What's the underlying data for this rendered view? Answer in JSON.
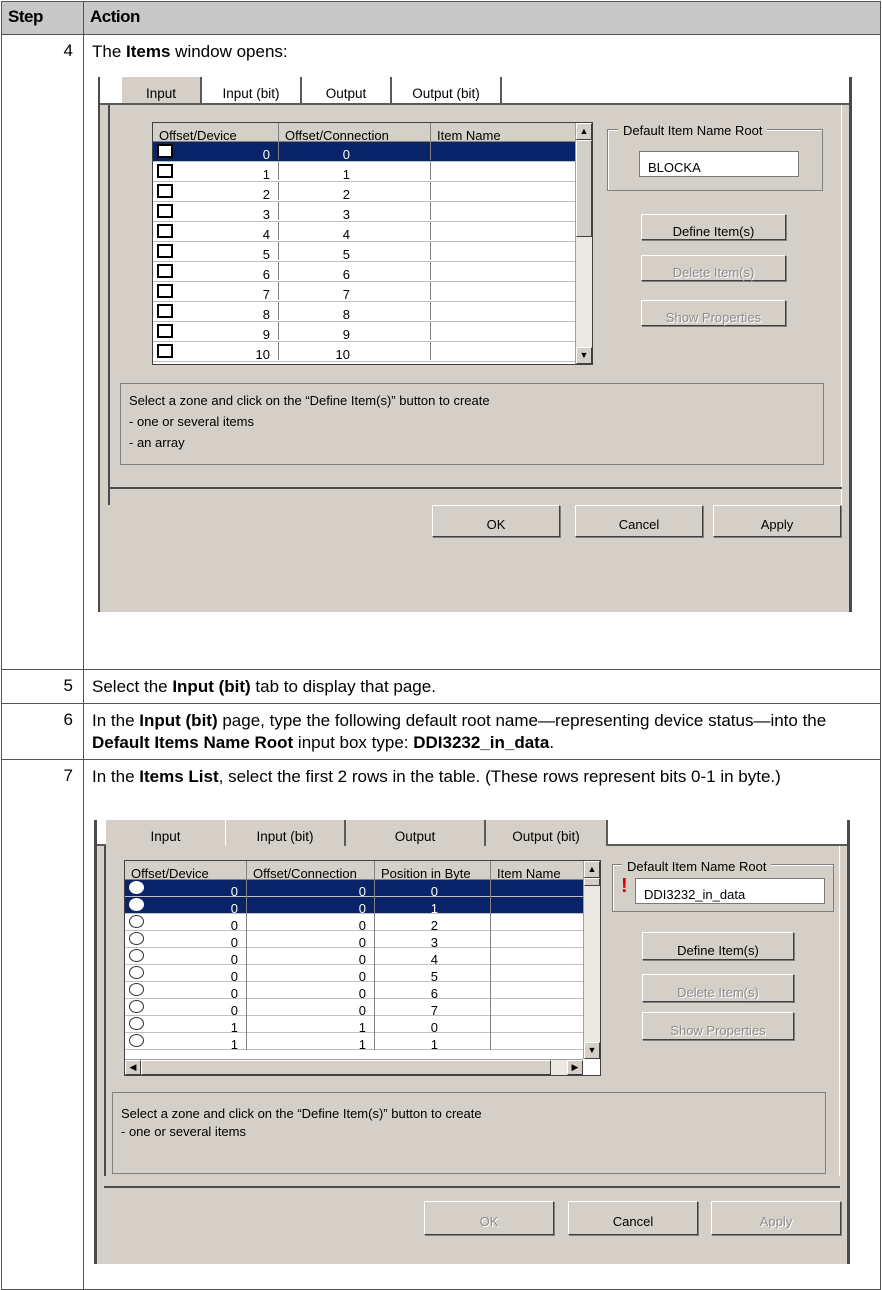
{
  "table": {
    "header_step": "Step",
    "header_action": "Action"
  },
  "steps": {
    "s4": {
      "num": "4",
      "t1": "The ",
      "b1": "Items",
      "t2": " window opens:"
    },
    "s5": {
      "num": "5",
      "t1": "Select the ",
      "b1": "Input (bit)",
      "t2": " tab to display that page."
    },
    "s6": {
      "num": "6",
      "t1": "In the ",
      "b1": "Input (bit)",
      "t2": " page, type the following default root name—representing device status—into the ",
      "b2": "Default Items Name Root",
      "t3": " input box type: ",
      "b3": "DDI3232_in_data",
      "t4": "."
    },
    "s7": {
      "num": "7",
      "t1": "In the ",
      "b1": "Items List",
      "t2": ", select the first 2 rows in the table. (These rows represent bits 0-1 in byte.)"
    }
  },
  "dialog1": {
    "tabs": [
      "Input",
      "Input (bit)",
      "Output",
      "Output (bit)"
    ],
    "columns": [
      "Offset/Device",
      "Offset/Connection",
      "Item Name"
    ],
    "rows": [
      {
        "device": "0",
        "connection": "0"
      },
      {
        "device": "1",
        "connection": "1"
      },
      {
        "device": "2",
        "connection": "2"
      },
      {
        "device": "3",
        "connection": "3"
      },
      {
        "device": "4",
        "connection": "4"
      },
      {
        "device": "5",
        "connection": "5"
      },
      {
        "device": "6",
        "connection": "6"
      },
      {
        "device": "7",
        "connection": "7"
      },
      {
        "device": "8",
        "connection": "8"
      },
      {
        "device": "9",
        "connection": "9"
      },
      {
        "device": "10",
        "connection": "10"
      }
    ],
    "selected_row": 0,
    "group_title": "Default Item Name Root",
    "root_value": "BLOCKA",
    "define_btn": "Define Item(s)",
    "delete_btn": "Delete Item(s)",
    "props_btn": "Show Properties",
    "hint_line1": "Select a zone and click on the “Define Item(s)” button to create",
    "hint_line2": "- one or several items",
    "hint_line3": "- an array",
    "ok": "OK",
    "cancel": "Cancel",
    "apply": "Apply"
  },
  "dialog2": {
    "tabs": [
      "Input",
      "Input (bit)",
      "Output",
      "Output (bit)"
    ],
    "columns": [
      "Offset/Device",
      "Offset/Connection",
      "Position in Byte",
      "Item Name"
    ],
    "rows": [
      {
        "device": "0",
        "connection": "0",
        "position": "0"
      },
      {
        "device": "0",
        "connection": "0",
        "position": "1"
      },
      {
        "device": "0",
        "connection": "0",
        "position": "2"
      },
      {
        "device": "0",
        "connection": "0",
        "position": "3"
      },
      {
        "device": "0",
        "connection": "0",
        "position": "4"
      },
      {
        "device": "0",
        "connection": "0",
        "position": "5"
      },
      {
        "device": "0",
        "connection": "0",
        "position": "6"
      },
      {
        "device": "0",
        "connection": "0",
        "position": "7"
      },
      {
        "device": "1",
        "connection": "1",
        "position": "0"
      },
      {
        "device": "1",
        "connection": "1",
        "position": "1"
      }
    ],
    "selected_rows": [
      0,
      1
    ],
    "group_title": "Default Item Name Root",
    "warning_mark": "!",
    "root_value": "DDI3232_in_data",
    "define_btn": "Define Item(s)",
    "delete_btn": "Delete Item(s)",
    "props_btn": "Show Properties",
    "hint_line1": "Select a zone and click on the “Define Item(s)” button to create",
    "hint_line2": "- one or several items",
    "ok": "OK",
    "cancel": "Cancel",
    "apply": "Apply"
  },
  "icons": {
    "scroll_up": "▲",
    "scroll_down": "▼",
    "scroll_left": "◀",
    "scroll_right": "▶"
  }
}
